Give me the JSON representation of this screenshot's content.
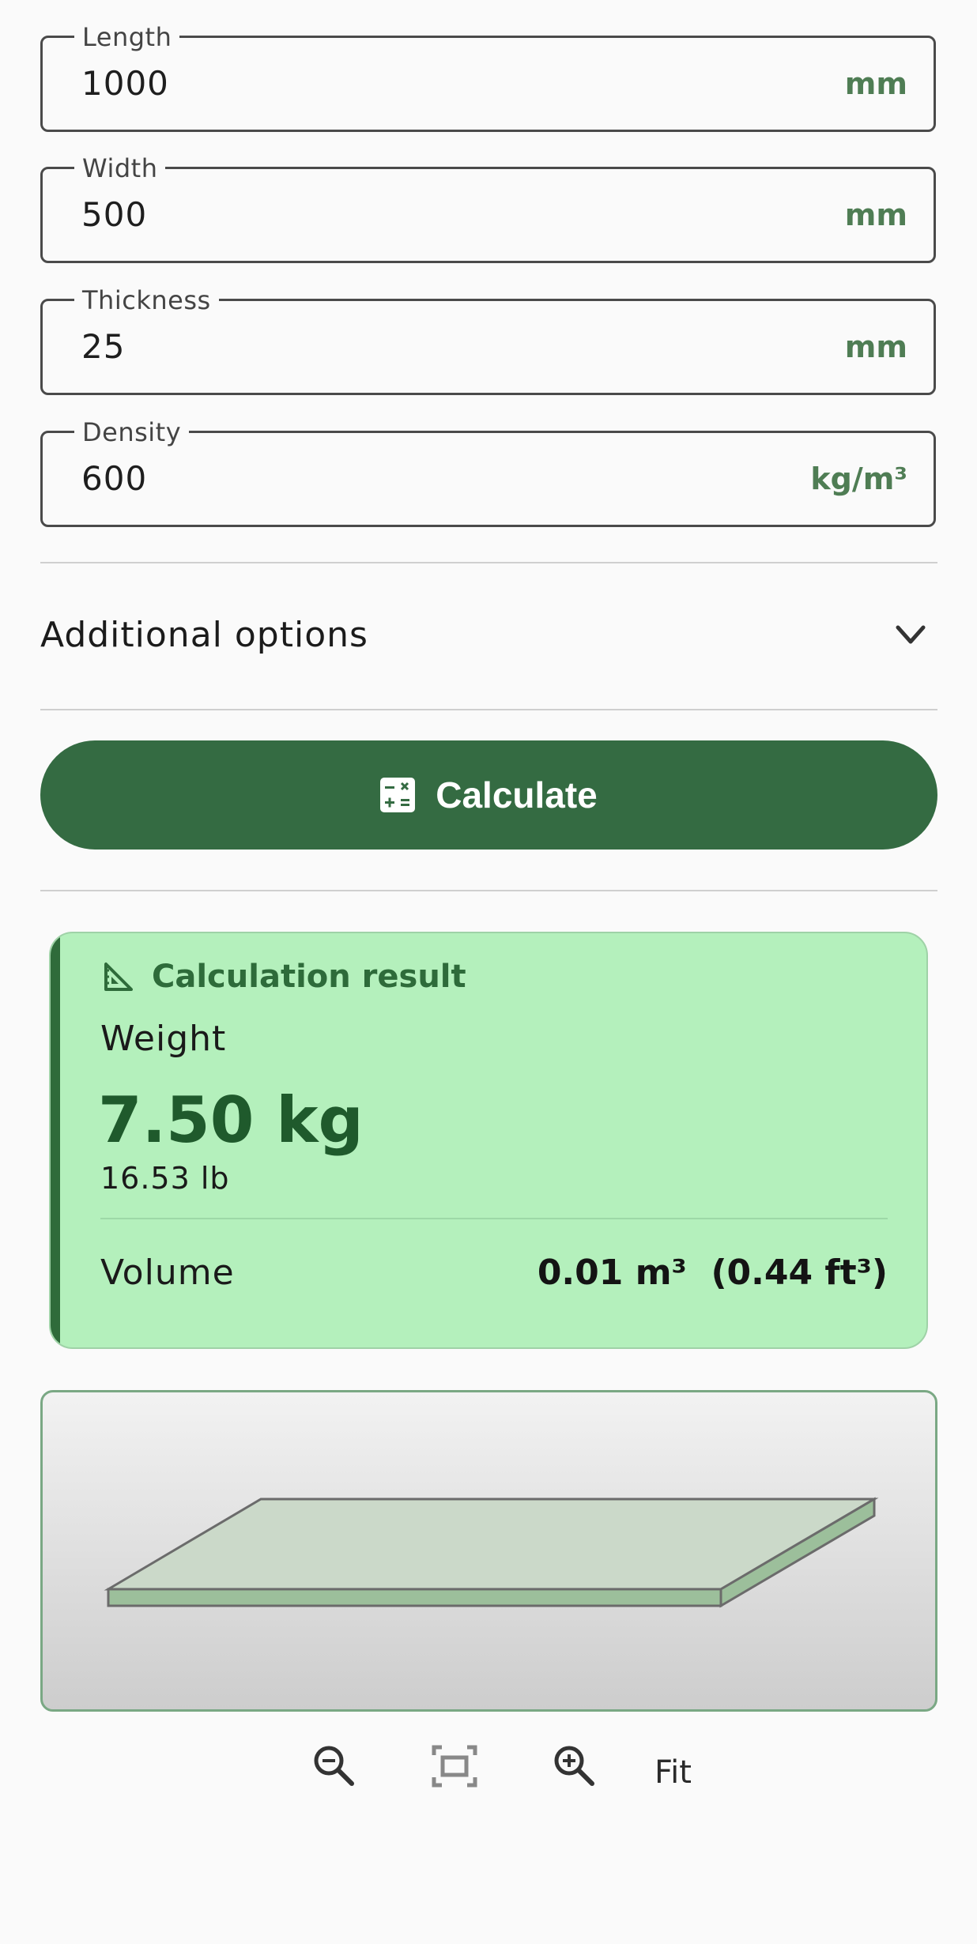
{
  "fields": [
    {
      "label": "Length",
      "value": "1000",
      "unit": "mm"
    },
    {
      "label": "Width",
      "value": "500",
      "unit": "mm"
    },
    {
      "label": "Thickness",
      "value": "25",
      "unit": "mm"
    },
    {
      "label": "Density",
      "value": "600",
      "unit": "kg/m³"
    }
  ],
  "options": {
    "label": "Additional options",
    "icon": "chevron-down-icon"
  },
  "calculate": {
    "label": "Calculate",
    "icon": "calculator-icon"
  },
  "result": {
    "title": "Calculation result",
    "icon": "set-square-icon",
    "weight_label": "Weight",
    "weight_value": "7.50 kg",
    "weight_lb": "16.53 lb",
    "volume_label": "Volume",
    "volume_value": "0.01 m³  (0.44 ft³)"
  },
  "viewer_controls": {
    "zoom_out_icon": "zoom-out-icon",
    "fit_icon": "fit-screen-icon",
    "zoom_in_icon": "zoom-in-icon",
    "fit_label": "Fit"
  },
  "colors": {
    "primary": "#346b42",
    "result_bg": "#b4f0bc",
    "unit_text": "#4f7d54",
    "board_top": "#cbd9c9",
    "board_side": "#9cbf9b"
  }
}
